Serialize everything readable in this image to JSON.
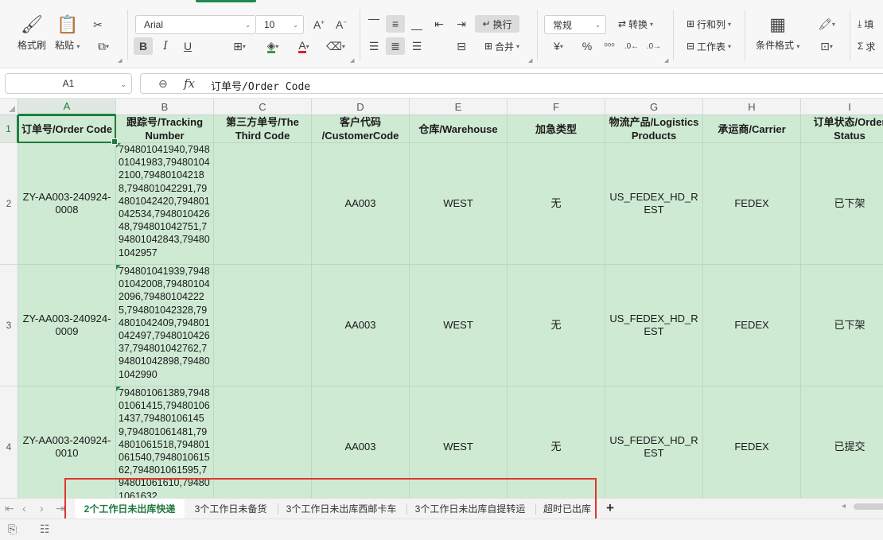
{
  "ribbon": {
    "format_painter": "格式刷",
    "paste": "粘贴",
    "font_name": "Arial",
    "font_size": "10",
    "wrap_text": "换行",
    "merge": "合并",
    "number_format": "常规",
    "convert": "转换",
    "rows_cols": "行和列",
    "worksheet": "工作表",
    "cond_format": "条件格式",
    "fill_partial": "填",
    "sum_partial": "求",
    "accent_color": "#1f8a4d"
  },
  "formula_bar": {
    "name_box": "A1",
    "fx": "fx",
    "content": "订单号/Order Code"
  },
  "columns": [
    "A",
    "B",
    "C",
    "D",
    "E",
    "F",
    "G",
    "H",
    "I"
  ],
  "rows": [
    "1",
    "2",
    "3",
    "4"
  ],
  "header_row": [
    "订单号/Order Code",
    "跟踪号/Tracking Number",
    "第三方单号/The Third Code",
    "客户代码 /CustomerCode",
    "仓库/Warehouse",
    "加急类型",
    "物流产品/Logistics Products",
    "承运商/Carrier",
    "订单状态/Order Status"
  ],
  "data_rows": [
    {
      "order_code": "ZY-AA003-240924-0008",
      "tracking": "794801041940,794801041983,794801042100,794801042188,794801042291,794801042420,794801042534,794801042648,794801042751,794801042843,794801042957",
      "third_code": "",
      "customer": "AA003",
      "warehouse": "WEST",
      "urgent": "无",
      "product": "US_FEDEX_HD_REST",
      "carrier": "FEDEX",
      "status": "已下架"
    },
    {
      "order_code": "ZY-AA003-240924-0009",
      "tracking": "794801041939,794801042008,794801042096,794801042225,794801042328,794801042409,794801042497,794801042637,794801042762,794801042898,794801042990",
      "third_code": "",
      "customer": "AA003",
      "warehouse": "WEST",
      "urgent": "无",
      "product": "US_FEDEX_HD_REST",
      "carrier": "FEDEX",
      "status": "已下架"
    },
    {
      "order_code": "ZY-AA003-240924-0010",
      "tracking": "794801061389,794801061415,794801061437,794801061459,794801061481,794801061518,794801061540,794801061562,794801061595,794801061610,794801061632",
      "third_code": "",
      "customer": "AA003",
      "warehouse": "WEST",
      "urgent": "无",
      "product": "US_FEDEX_HD_REST",
      "carrier": "FEDEX",
      "status": "已提交"
    }
  ],
  "sheet_tabs": [
    "2个工作日未出库快递",
    "3个工作日未备货",
    "3个工作日未出库西邮卡车",
    "3个工作日未出库自提转运",
    "超时已出库"
  ],
  "active_sheet": 0,
  "add_sheet": "+"
}
